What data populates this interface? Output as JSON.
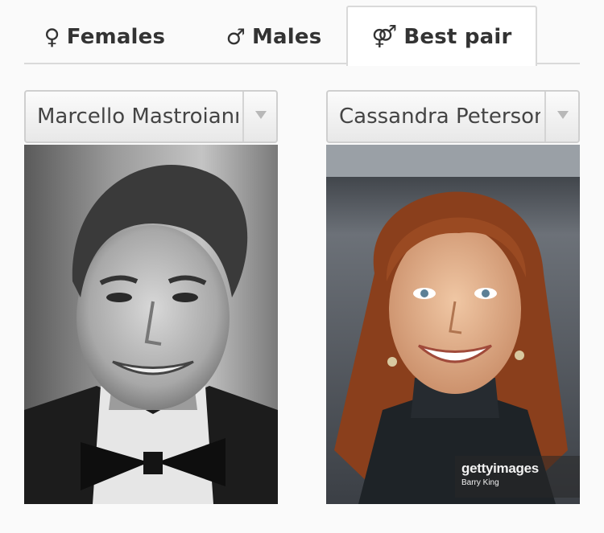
{
  "tabs": {
    "females": {
      "symbol": "♀",
      "label": "Females"
    },
    "males": {
      "symbol": "♂",
      "label": "Males"
    },
    "best_pair": {
      "symbol": "⚤",
      "label": "Best pair",
      "active": true
    }
  },
  "selectors": {
    "left": {
      "value": "Marcello Mastroianni"
    },
    "right": {
      "value": "Cassandra Peterson"
    }
  },
  "photos": {
    "left": {
      "style": "black-and-white portrait"
    },
    "right": {
      "watermark_logo": "gettyimages",
      "watermark_credit": "Barry King"
    }
  },
  "colors": {
    "tab_text": "#333333",
    "border": "#d9d9d9",
    "hair_right": "#8a3f1c"
  }
}
